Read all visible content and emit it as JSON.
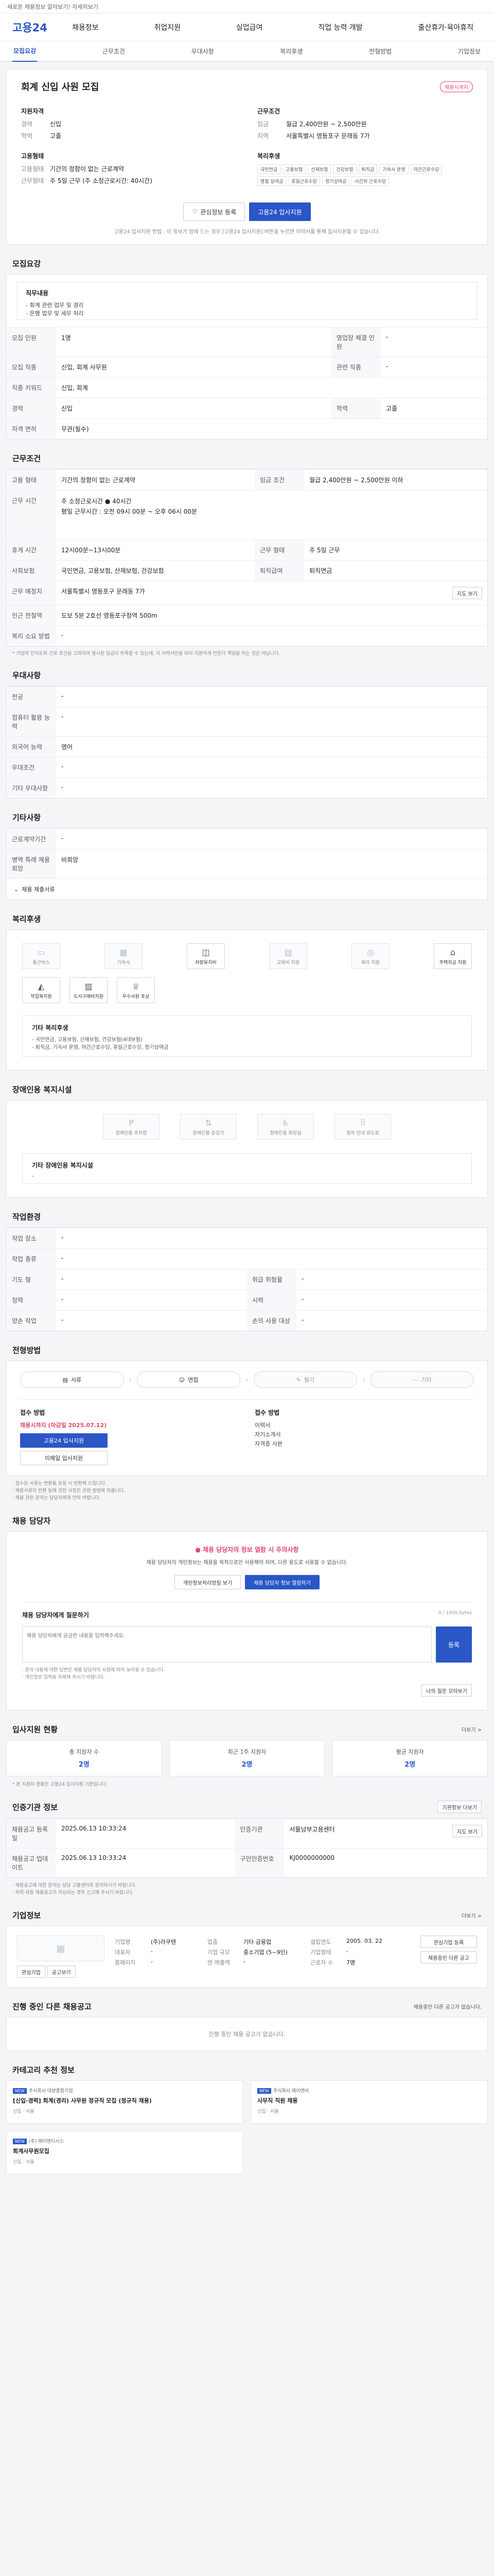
{
  "topbar": {
    "text": "새로운 채용정보 알아보기! 자세히보기"
  },
  "header": {
    "logo": "고용24",
    "nav": [
      "채용정보",
      "취업지원",
      "실업급여",
      "직업 능력 개발",
      "출산휴가·육아휴직"
    ]
  },
  "tabs": [
    "모집요강",
    "근무조건",
    "우대사항",
    "복리후생",
    "전형방법",
    "기업정보"
  ],
  "job": {
    "badge": "채용시까지",
    "title": "회계 신입 사원 모집",
    "left_title": "지원자격",
    "left": [
      {
        "k": "경력",
        "v": "신입"
      },
      {
        "k": "학력",
        "v": "고졸"
      }
    ],
    "left2_title": "고용형태",
    "left2": [
      {
        "k": "고용형태",
        "v": "기간의 정함이 없는 근로계약"
      },
      {
        "k": "근무형태",
        "v": "주 5일 근무 (주 소정근로시간: 40시간)"
      }
    ],
    "right_title": "근무조건",
    "right": [
      {
        "k": "임금",
        "v": "월급 2,400만원 ~ 2,500만원"
      },
      {
        "k": "지역",
        "v": "서울특별시 영등포구 문래동 7가"
      }
    ],
    "right2_title": "복리후생",
    "welfare": [
      "국민연금",
      "고용보험",
      "산재보험",
      "건강보험"
    ],
    "welfare2": [
      "퇴직금",
      "기숙사 운영",
      "야간근로수당",
      "명절 상여금",
      "휴일근로수당",
      "정기상여금",
      "시간외 근로수당"
    ],
    "btn_interest": "관심정보 등록",
    "btn_apply": "고용24 입사지원",
    "note": "고용24 입사지원 방법 : 이 정보가 맘에 드는 경우 [고용24 입사지원] 버튼을 누르면 이력서를 통해 입사지원할 수 있습니다."
  },
  "recruit": {
    "title": "모집요강",
    "duty_label": "직무내용",
    "duty_lines": [
      "- 회계 관련 업무 및 경리",
      "- 은행 업무 및 세무 처리"
    ],
    "rows": [
      [
        "모집 인원",
        "1명",
        "영업장 체결 인원",
        "-"
      ],
      [
        "모집 직종",
        "신입, 회계 사무원",
        "관련 직종",
        "-"
      ],
      [
        "직종 키워드",
        "신입, 회계",
        "",
        ""
      ],
      [
        "경력",
        "신입",
        "학력",
        "고졸"
      ],
      [
        "자격 면허",
        "무관(필수)",
        "",
        ""
      ]
    ]
  },
  "work": {
    "title": "근무조건",
    "rows": [
      [
        "고용 형태",
        "기간의 정함이 없는 근로계약",
        "임금 조건",
        "월급 2,400만원 ~ 2,500만원 이하"
      ],
      [
        "근무 시간",
        "주 소정근로시간 ● 40시간\n평일 근무시간 : 오전 09시 00분 ~ 오후 06시 00분",
        "",
        ""
      ],
      [
        "휴게 시간",
        "12시00분~13시00분",
        "근무 형태",
        "주 5일 근무"
      ],
      [
        "사회보험",
        "국민연금, 고용보험, 산재보험, 건강보험",
        "퇴직급여",
        "퇴직연금"
      ],
      [
        "근무 예정지",
        "서울특별시 영등포구 문래동 7가",
        "",
        ""
      ],
      [
        "인근 전철역",
        "도보 5분 2호선 영등포구청역 500m",
        "",
        ""
      ],
      [
        "복리 소요 방법",
        "-",
        "",
        ""
      ]
    ],
    "map_btn": "지도 보기",
    "note": "* 기업의 인지도와 근로 조건을 고려하여 명시된 임금이 부족할 수 있는데, 이 이력서만을 따라 지원하게 만든다 책임을 지는 것은 아닙니다."
  },
  "prefer": {
    "title": "우대사항",
    "rows": [
      [
        "전공",
        "-"
      ],
      [
        "컴퓨터 활용 능력",
        "-"
      ],
      [
        "외국어 능력",
        "영어"
      ],
      [
        "우대조건",
        "-"
      ],
      [
        "기타 우대사항",
        "-"
      ]
    ]
  },
  "etc": {
    "title": "기타사항",
    "rows": [
      [
        "근로계약기간",
        "-"
      ],
      [
        "병역 특례 채용 희망",
        "비희망"
      ]
    ],
    "toggle": "채용 제출서류"
  },
  "welfare": {
    "title": "복리후생",
    "cards": [
      {
        "label": "통근버스",
        "on": false
      },
      {
        "label": "기숙사",
        "on": false
      },
      {
        "label": "차량유지비",
        "on": true
      },
      {
        "label": "교육비 지원",
        "on": false
      },
      {
        "label": "육아 지원",
        "on": false
      },
      {
        "label": "주택자금 지원",
        "on": true
      },
      {
        "label": "작업복지원",
        "on": true
      },
      {
        "label": "도서구매비지원",
        "on": true
      },
      {
        "label": "우수사원 포상",
        "on": true
      }
    ],
    "box_title": "기타 복리후생",
    "box_lines": [
      "- 국민연금, 고용보험, 산재보험, 건강보험(4대보험)",
      "- 퇴직금, 기숙사 운영, 야간근로수당, 휴일근로수당, 정기상여금"
    ]
  },
  "disabled": {
    "title": "장애인용 복지시설",
    "cards": [
      "장애인용 주차장",
      "장애인용 승강기",
      "장애인용 화장실",
      "점자 안내 유도로"
    ],
    "box_title": "기타 장애인용 복지시설",
    "box_line": "-"
  },
  "environment": {
    "title": "작업환경",
    "rows": [
      [
        "작업 장소",
        "-",
        "",
        ""
      ],
      [
        "작업 종류",
        "-",
        "",
        ""
      ],
      [
        "기도 형",
        "-",
        "취급 위험물",
        "-"
      ],
      [
        "청력",
        "-",
        "시력",
        "-"
      ],
      [
        "양손 작업",
        "-",
        "손의 사용 대상",
        "-"
      ]
    ]
  },
  "process": {
    "title": "전형방법",
    "steps": [
      "서류",
      "면접",
      "필기",
      "기타"
    ],
    "apply_label": "접수 방법",
    "apply_lines": [
      "채용시까지 (마감일 2025.07.12)",
      "고용24 입사지원",
      "이메일"
    ],
    "apply_btn": "고용24 입사지원",
    "email_btn": "이메일 입사지원",
    "doc_label": "접수 방법",
    "doc_lines": [
      "이력서",
      "자기소개서",
      "자격증 사본"
    ],
    "notes": [
      "· 접수된 서류는 반환을 요청 시 반환해 드립니다.",
      "· 채용서류의 반환 등에 관한 사항은 관련 법령에 따릅니다.",
      "· 채용 관련 문의는 담당자에게 연락 바랍니다."
    ]
  },
  "contact": {
    "title": "채용 담당자",
    "warn_title": "채용 담당자의 정보 열람 시 주의사항",
    "warn_text": "채용 담당자의 개인정보는 채용을 목적으로만 사용해야 하며, 다른 용도로 사용할 수 없습니다.",
    "btn_view": "개인정보처리방침 보기",
    "btn_show": "채용 담당자 정보 열람하기",
    "inq_label": "채용 담당자에게 질문하기",
    "inq_count": "0 / 1000 bytes",
    "inq_placeholder": "채용 담당자에게 궁금한 내용을 입력해주세요.",
    "inq_btn": "등록",
    "notes": [
      "· 문의 내용에 대한 답변은 채용 담당자의 사정에 따라 늦어질 수 있습니다.",
      "· 개인정보 입력을 자제해 주시기 바랍니다."
    ],
    "more_btn": "나의 질문 모아보기"
  },
  "status": {
    "title": "입사지원 현황",
    "more": "더보기 >",
    "stats": [
      {
        "label": "총 지원자 수",
        "value": "2명"
      },
      {
        "label": "최근 1주 지원자",
        "value": "2명"
      },
      {
        "label": "평균 지원자",
        "value": "2명"
      }
    ],
    "note": "* 본 지원자 현황은 고용24 입사지원 기준입니다."
  },
  "info": {
    "title": "인증기관 정보",
    "btn": "기관정보 더보기",
    "rows": [
      [
        "채용공고 등록일",
        "2025.06.13 10:33:24",
        "인증기관",
        "서울남부고용센터"
      ],
      [
        "채용공고 업데이트",
        "2025.06.13 10:33:24",
        "구인인증번호",
        "KJ0000000000"
      ]
    ],
    "map_btn": "지도 보기",
    "notes": [
      "· 채용공고에 대한 문의는 담당 고용센터로 문의하시기 바랍니다.",
      "· 허위·과장 채용공고가 의심되는 경우 신고해 주시기 바랍니다."
    ]
  },
  "company": {
    "title": "기업정보",
    "more": "더보기 >",
    "rows": [
      [
        "기업명",
        "(주)라쿠텐",
        "업종",
        "기타 금융업",
        "설립연도",
        "2005. 03. 22"
      ],
      [
        "대표자",
        "-",
        "기업 규모",
        "중소기업 (5~9인)",
        "기업형태",
        "-"
      ],
      [
        "홈페이지",
        "-",
        "연 매출액",
        "-",
        "근로자 수",
        "7명"
      ]
    ],
    "btn_interest": "관심기업 등록",
    "btn_other": "채용중인 다른 공고",
    "btn_a": "관심기업",
    "btn_b": "공고보기"
  },
  "other_jobs": {
    "title": "진행 중인 다른 채용공고",
    "more": "채용중인 다른 공고가 없습니다.",
    "empty": "진행 중인 채용 공고가 없습니다."
  },
  "recommend": {
    "title": "카테고리 추천 정보",
    "cards": [
      {
        "tag": "NEW",
        "head": "주식회사 대양종합기업",
        "title": "[신입·경력] 회계(경리) 사무원 정규직 모집 (정규직 채용)",
        "meta": "신입 · 서울"
      },
      {
        "tag": "NEW",
        "head": "주식회사 에이앤비",
        "title": "사무직 직원 채용",
        "meta": "신입 · 서울"
      },
      {
        "tag": "NEW",
        "head": "(주) 에이앤디시스",
        "title": "회계사무원모집",
        "meta": "신입 · 서울"
      }
    ]
  }
}
